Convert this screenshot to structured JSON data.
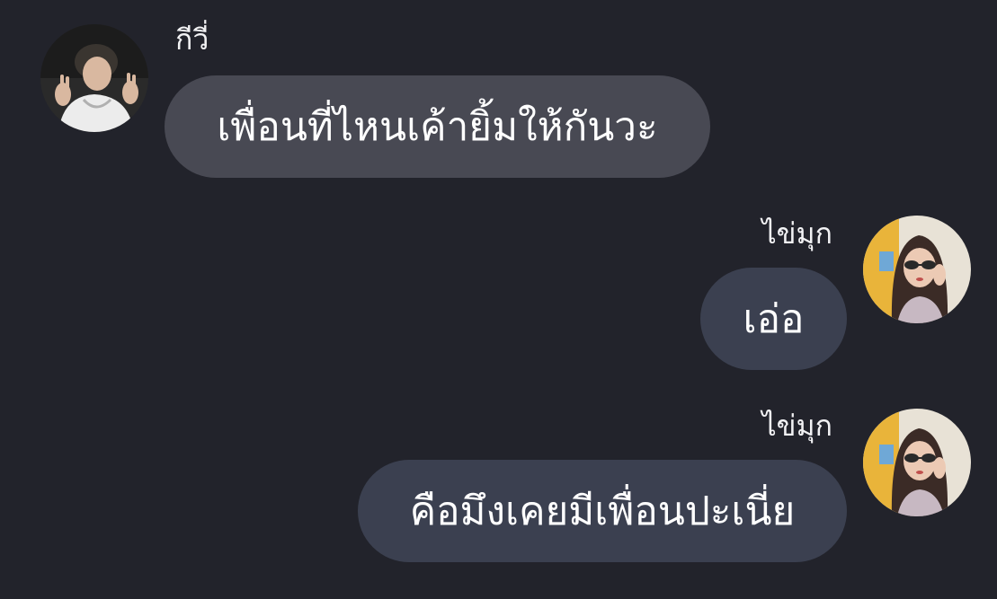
{
  "chat": {
    "messages": [
      {
        "sender": "กีวี่",
        "text": "เพื่อนที่ไหนเค้ายิ้มให้กันวะ",
        "direction": "incoming",
        "avatar_icon": "avatar-photo-icon"
      },
      {
        "sender": "ไข่มุก",
        "text": "เอ่อ",
        "direction": "outgoing",
        "avatar_icon": "avatar-photo-icon"
      },
      {
        "sender": "ไข่มุก",
        "text": "คือมึงเคยมีเพื่อนปะเนี่ย",
        "direction": "outgoing",
        "avatar_icon": "avatar-photo-icon"
      }
    ]
  },
  "colors": {
    "background": "#22232b",
    "incoming_bubble": "#484953",
    "outgoing_bubble": "#3b4050",
    "text": "#ffffff"
  }
}
